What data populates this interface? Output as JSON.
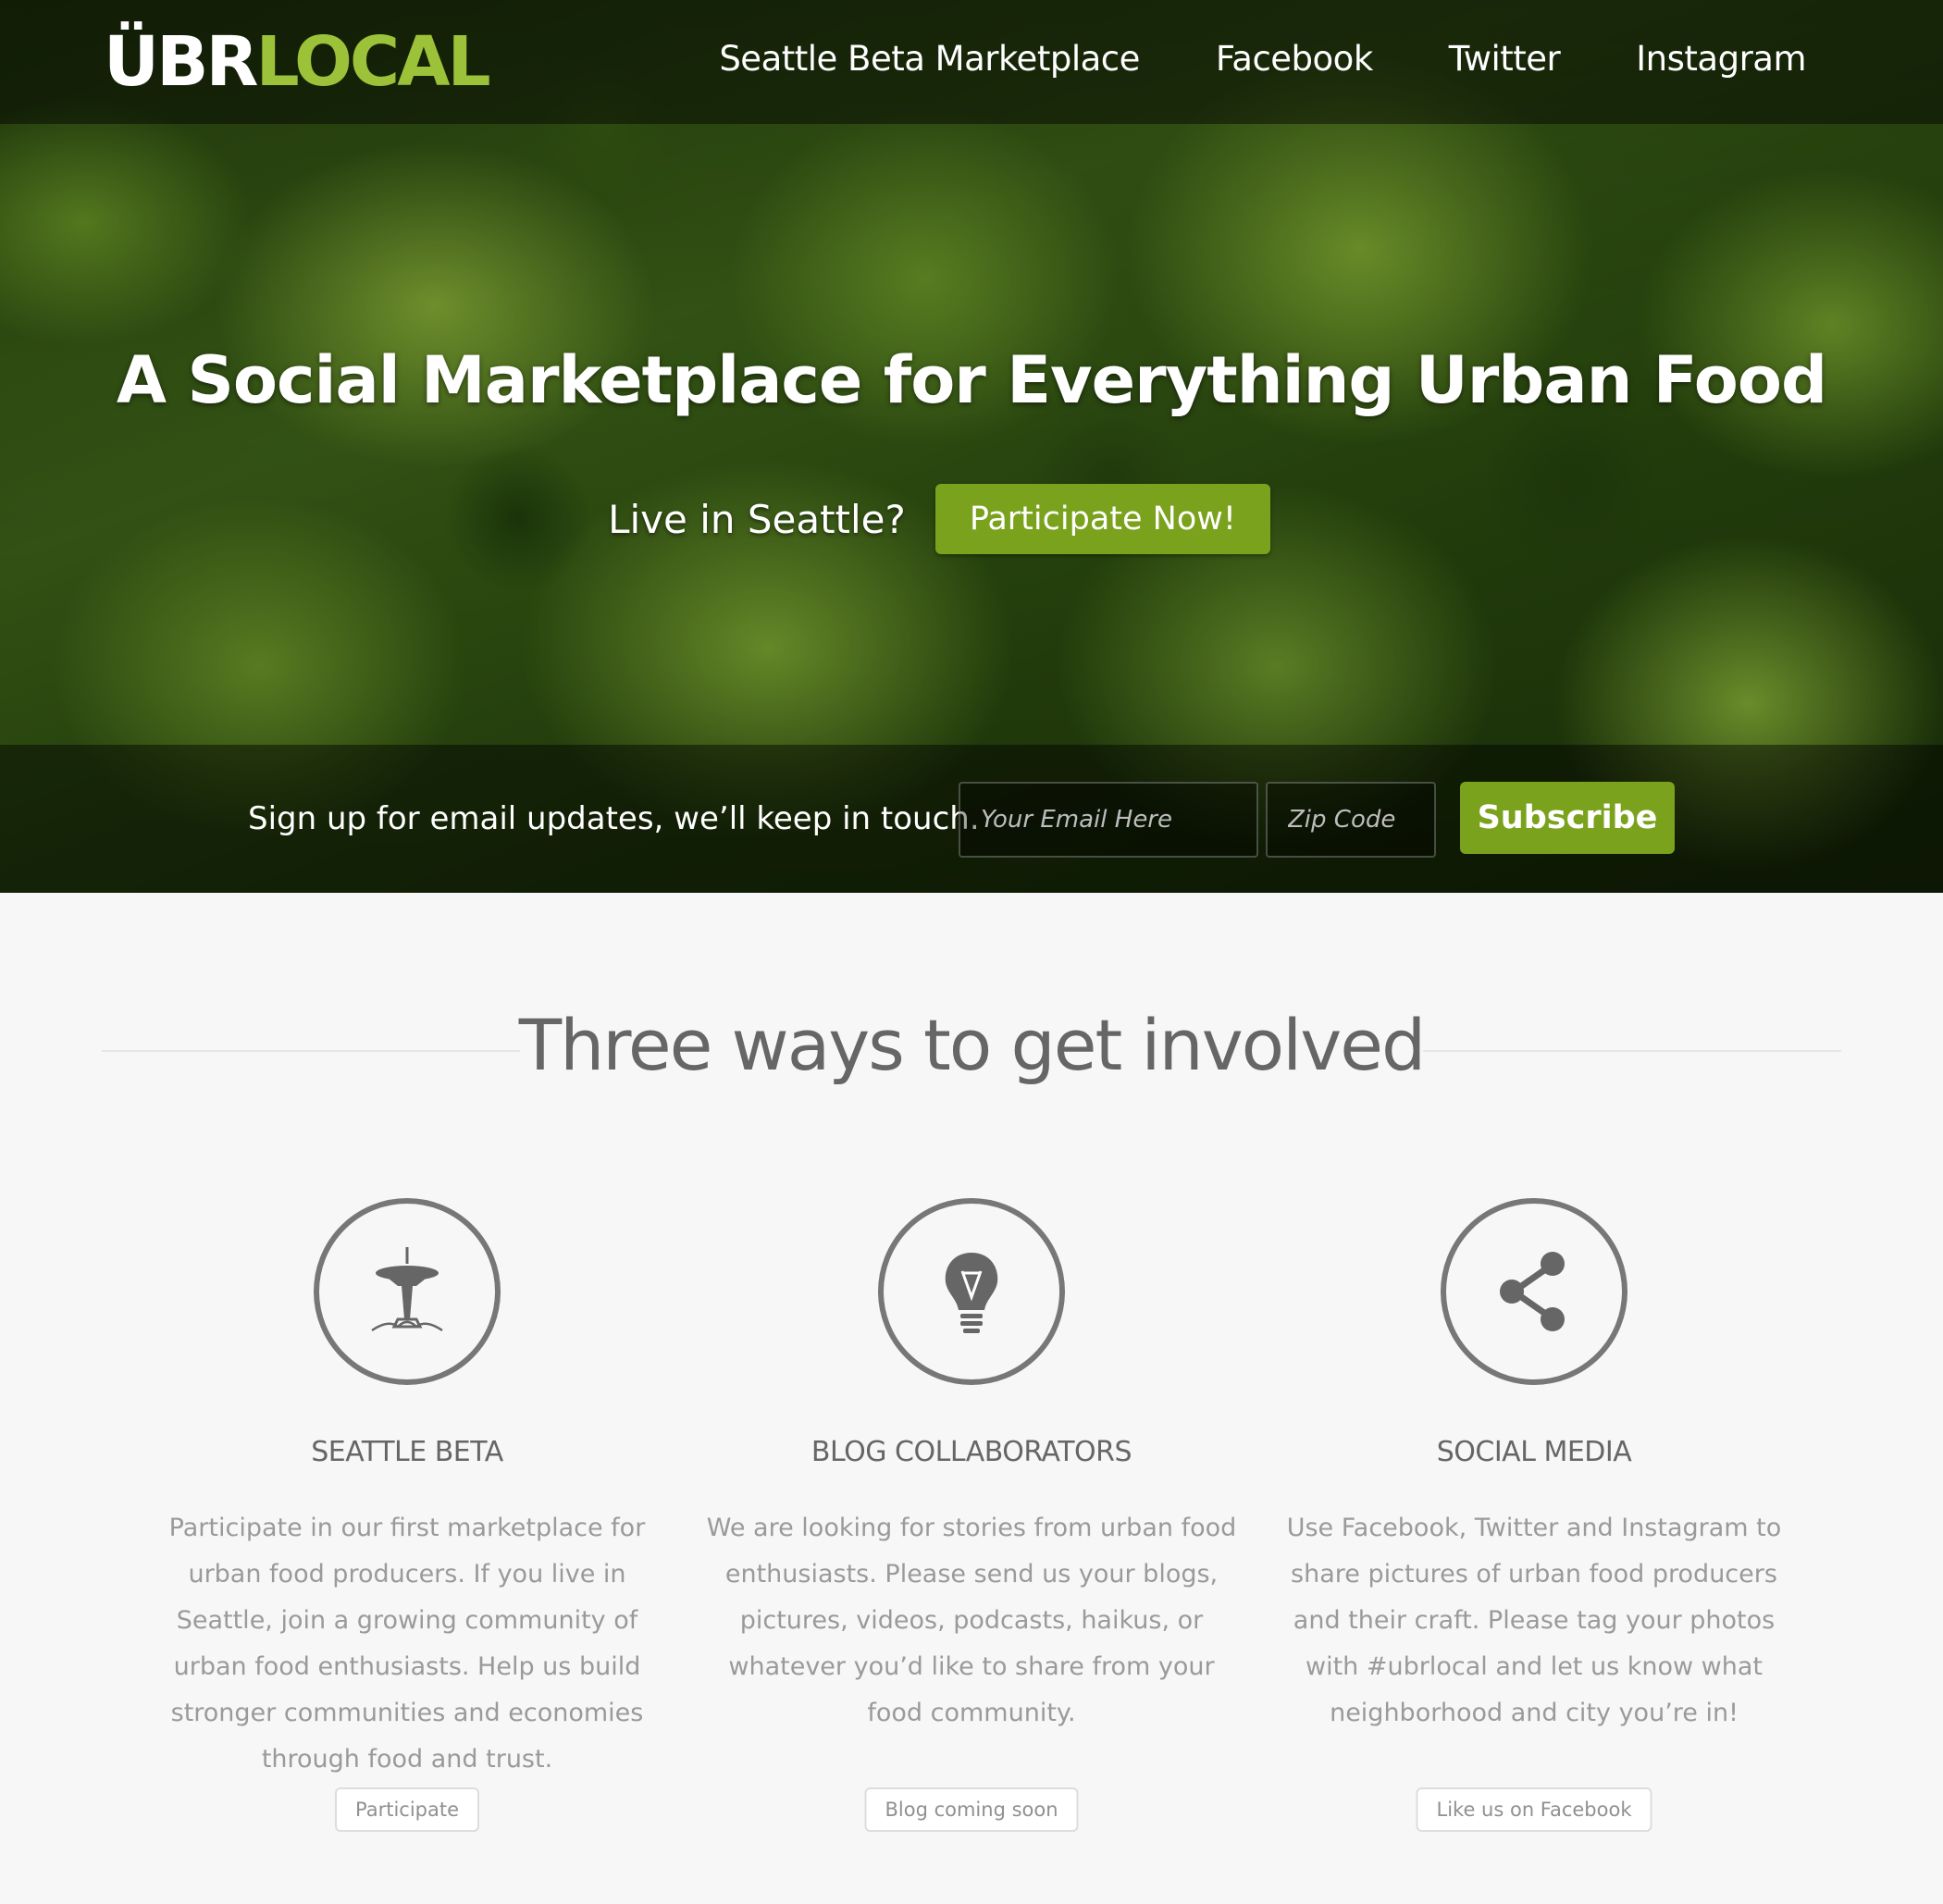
{
  "header": {
    "logo_part1": "ÜBR",
    "logo_part2": "LOCAL",
    "nav": [
      "Seattle Beta Marketplace",
      "Facebook",
      "Twitter",
      "Instagram"
    ]
  },
  "hero": {
    "headline": "A Social Marketplace for Everything Urban Food",
    "cta_text": "Live in Seattle?",
    "cta_button": "Participate Now!"
  },
  "signup": {
    "text": "Sign up for email updates, we’ll keep in touch.",
    "email_placeholder": "Your Email Here",
    "zip_placeholder": "Zip Code",
    "subscribe_label": "Subscribe"
  },
  "section": {
    "title": "Three ways to get involved",
    "columns": [
      {
        "icon": "space-needle-icon",
        "title": "SEATTLE BETA",
        "body": "Participate in our first marketplace for urban food producers. If you live in Seattle, join a growing community of urban food enthusiasts. Help us build stronger communities and economies through food and trust.",
        "button": "Participate"
      },
      {
        "icon": "lightbulb-icon",
        "title": "BLOG COLLABORATORS",
        "body": "We are looking for stories from urban food enthusiasts. Please send us your blogs, pictures, videos, podcasts, haikus, or whatever you’d like to share from your food community.",
        "button": "Blog coming soon"
      },
      {
        "icon": "share-icon",
        "title": "SOCIAL MEDIA",
        "body": "Use Facebook, Twitter and Instagram to share pictures of urban food producers and their craft. Please tag your photos with #ubrlocal and let us know what neighborhood and city you’re in!",
        "button": "Like us on Facebook"
      }
    ]
  },
  "colors": {
    "accent_green": "#7ba21d",
    "logo_green": "#9cc23a",
    "text_gray": "#666666"
  }
}
